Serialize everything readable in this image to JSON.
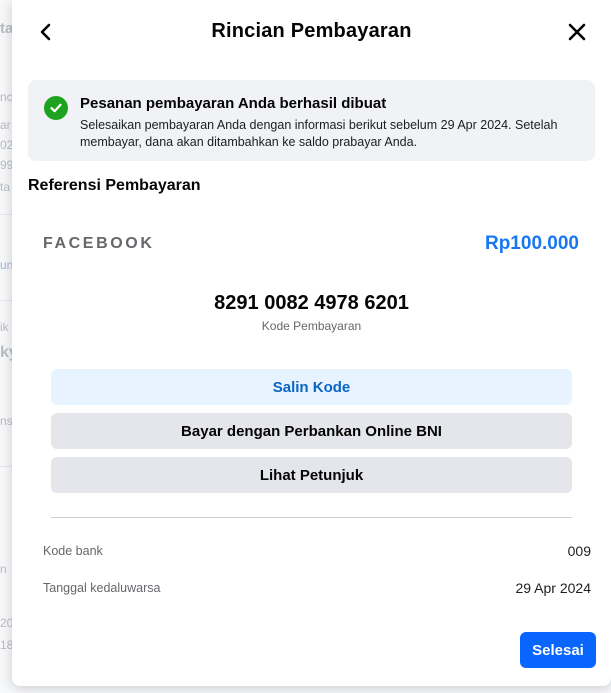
{
  "header": {
    "title": "Rincian Pembayaran"
  },
  "success": {
    "title": "Pesanan pembayaran Anda berhasil dibuat",
    "description": "Selesaikan pembayaran Anda dengan informasi berikut sebelum 29 Apr 2024. Setelah membayar, dana akan ditambahkan ke saldo prabayar Anda."
  },
  "reference": {
    "section_title": "Referensi Pembayaran",
    "merchant": "FACEBOOK",
    "amount": "Rp100.000",
    "payment_code": "8291 0082 4978 6201",
    "payment_code_label": "Kode Pembayaran"
  },
  "actions": {
    "copy_label": "Salin Kode",
    "bank_label": "Bayar dengan Perbankan Online BNI",
    "guide_label": "Lihat Petunjuk"
  },
  "details": [
    {
      "label": "Kode bank",
      "value": "009"
    },
    {
      "label": "Tanggal kedaluwarsa",
      "value": "29 Apr 2024"
    }
  ],
  "footer": {
    "done_label": "Selesai"
  },
  "background": {
    "fragments": [
      "ta",
      "nc",
      "ar",
      "02",
      "99",
      "ta",
      "un",
      "ik",
      "ky",
      "ns",
      "n",
      "20",
      "18"
    ]
  },
  "colors": {
    "accent": "#1877f2",
    "primary_button": "#0866ff",
    "success": "#1fa21f",
    "copy_button_bg": "#e7f3ff",
    "copy_button_text": "#0a66c2"
  },
  "icons": {
    "back": "chevron-left-icon",
    "close": "close-icon",
    "success": "check-circle-icon"
  }
}
